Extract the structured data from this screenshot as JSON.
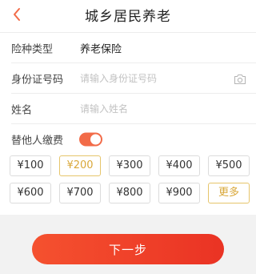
{
  "header": {
    "title": "城乡居民养老",
    "back_icon": "chevron-left-icon",
    "accent_color": "#f26b48"
  },
  "form": {
    "insurance_type": {
      "label": "险种类型",
      "value": "养老保险"
    },
    "id_number": {
      "label": "身份证号码",
      "value": "",
      "placeholder": "请输入身份证号码",
      "icon": "camera-icon"
    },
    "name": {
      "label": "姓名",
      "value": "",
      "placeholder": "请输入姓名"
    },
    "pay_for_others": {
      "label": "替他人缴费",
      "enabled": true
    }
  },
  "amounts": {
    "options": [
      "¥100",
      "¥200",
      "¥300",
      "¥400",
      "¥500",
      "¥600",
      "¥700",
      "¥800",
      "¥900"
    ],
    "selected": "¥200",
    "more_label": "更多",
    "selected_color": "#d9a83a"
  },
  "footer": {
    "next_label": "下一步",
    "button_color": "#f04a2c"
  }
}
